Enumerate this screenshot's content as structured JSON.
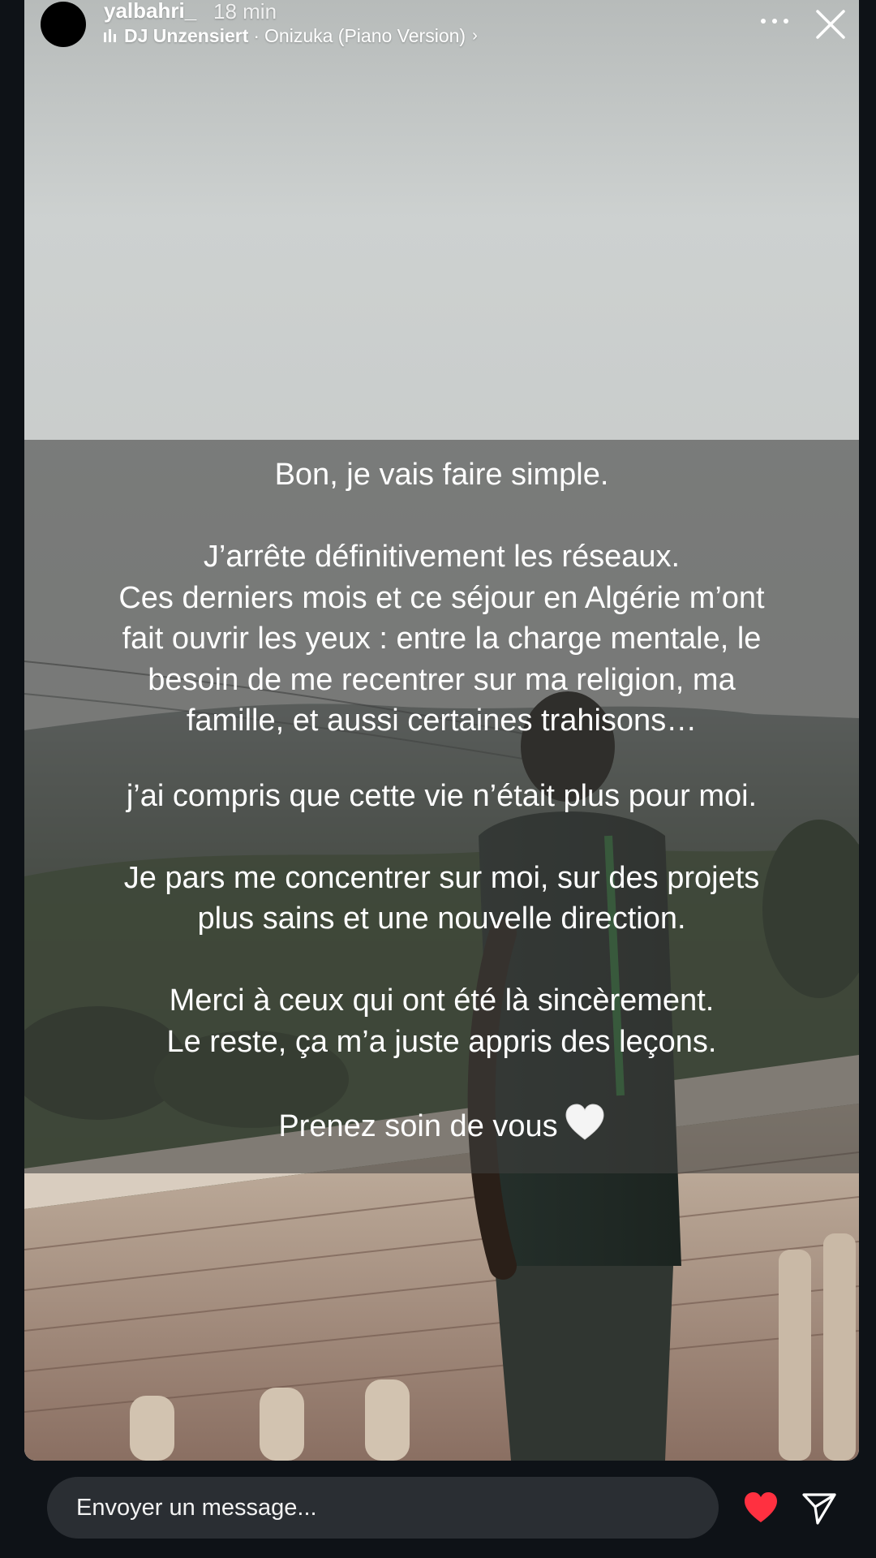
{
  "header": {
    "username": "yalbahri_",
    "time": "18 min",
    "music": {
      "artist": "DJ Unzensiert",
      "separator": "·",
      "track": "Onizuka (Piano Version)",
      "chevron": "›"
    },
    "more_icon": "more-horizontal-icon",
    "close_icon": "close-icon"
  },
  "story": {
    "lines": [
      "Bon, je vais faire simple.",
      "",
      "J’arrête définitivement les réseaux.",
      "Ces derniers mois et ce séjour en Algérie m’ont",
      "fait ouvrir les yeux : entre la charge mentale, le",
      "besoin de me recentrer sur ma religion, ma",
      "famille, et aussi certaines trahisons…",
      "",
      "j’ai compris que cette vie n’était plus pour moi.",
      "",
      "Je pars me concentrer sur moi, sur des projets",
      "plus sains et une nouvelle direction.",
      "",
      "Merci à ceux qui ont été là sincèrement.",
      "Le reste, ça m’a juste appris des leçons.",
      "",
      "Prenez soin de vous"
    ],
    "closing_emoji": "white-heart-icon"
  },
  "footer": {
    "message_placeholder": "Envoyer un message...",
    "like_icon": "heart-icon",
    "send_icon": "send-icon"
  },
  "colors": {
    "background": "#0e1217",
    "input_bg": "#2a2e33",
    "like_red": "#ff3040",
    "text": "#ffffff"
  }
}
